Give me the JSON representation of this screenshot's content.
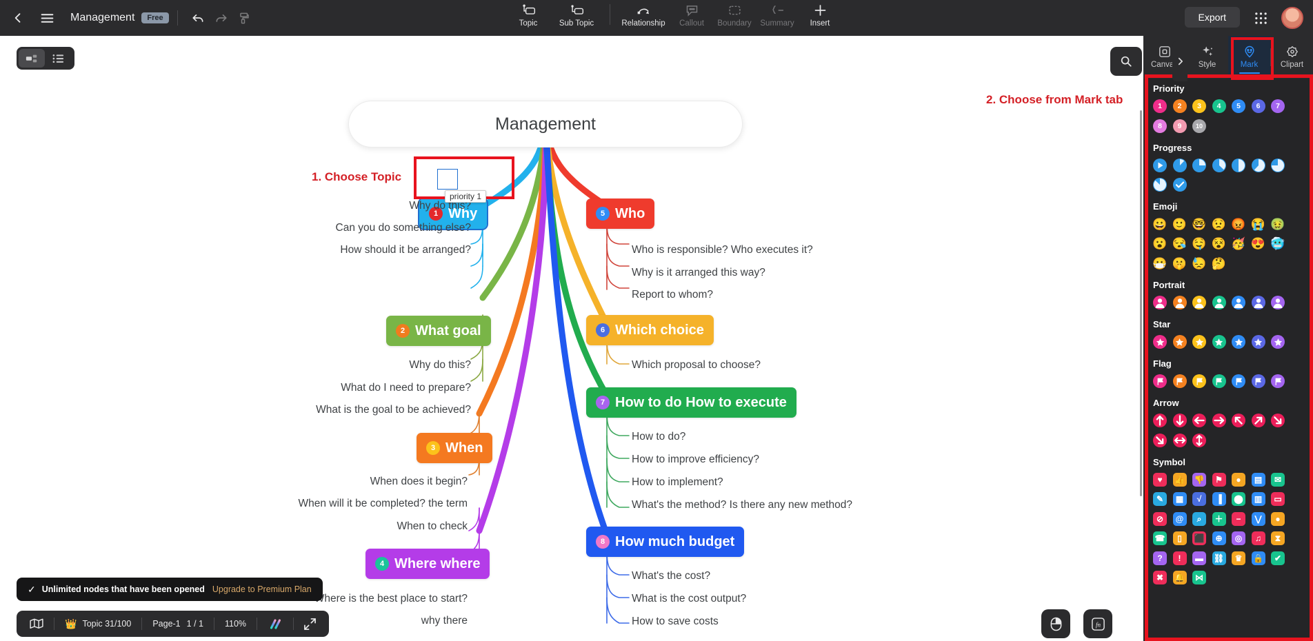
{
  "topbar": {
    "back_icon": "chevron-left-icon",
    "menu_icon": "hamburger-menu-icon",
    "doc_title": "Management",
    "plan_badge": "Free",
    "undo_icon": "undo-arrow-icon",
    "redo_icon": "redo-arrow-icon",
    "paint_icon": "format-painter-icon",
    "tools": [
      {
        "label": "Topic",
        "icon": "topic-icon",
        "dim": false
      },
      {
        "label": "Sub Topic",
        "icon": "sub-topic-icon",
        "dim": false
      },
      {
        "label": "Relationship",
        "icon": "relationship-arc-icon",
        "dim": false
      },
      {
        "label": "Callout",
        "icon": "callout-bubble-icon",
        "dim": true
      },
      {
        "label": "Boundary",
        "icon": "boundary-icon",
        "dim": true
      },
      {
        "label": "Summary",
        "icon": "summary-bracket-icon",
        "dim": true
      },
      {
        "label": "Insert",
        "icon": "plus-icon",
        "dim": false
      }
    ],
    "export_label": "Export",
    "grid_icon": "apps-grid-icon",
    "avatar_icon": "user-avatar"
  },
  "canvas_controls": {
    "view_map_icon": "mindmap-view-icon",
    "view_outline_icon": "outline-list-icon",
    "search_icon": "search-icon",
    "collapse_icon": "chevron-right-icon"
  },
  "annotations": {
    "step1": "1. Choose Topic",
    "step2": "2. Choose from Mark tab",
    "accent_color": "#d42026"
  },
  "mindmap": {
    "root": "Management",
    "tooltip": "priority 1",
    "branches": [
      {
        "title": "Why",
        "number": "1",
        "color": "#22b1ec",
        "badge_color": "#e4282b",
        "side": "left",
        "selected": true,
        "children": [
          "Why do this?",
          "Can you do something else?",
          "How should it be arranged?"
        ]
      },
      {
        "title": "What goal",
        "number": "2",
        "color": "#79b547",
        "badge_color": "#f07c1e",
        "side": "left",
        "selected": false,
        "children": [
          "Why do this?",
          "What do I need to prepare?",
          "What is the goal to be achieved?"
        ]
      },
      {
        "title": "When",
        "number": "3",
        "color": "#f47920",
        "badge_color": "#fcc21b",
        "side": "left",
        "selected": false,
        "children": [
          "When does it begin?",
          "When will it be completed? the term",
          "When to check"
        ]
      },
      {
        "title": "Where where",
        "number": "4",
        "color": "#b43ce8",
        "badge_color": "#1bc49a",
        "side": "left",
        "selected": false,
        "children": [
          "Where is the best place to start?",
          "why there"
        ]
      },
      {
        "title": "Who",
        "number": "5",
        "color": "#ef3b2d",
        "badge_color": "#2f8cf5",
        "side": "right",
        "selected": false,
        "children": [
          "Who is responsible? Who executes it?",
          "Why is it arranged this way?",
          "Report to whom?"
        ]
      },
      {
        "title": "Which choice",
        "number": "6",
        "color": "#f5b22a",
        "badge_color": "#4a6ee0",
        "side": "right",
        "selected": false,
        "children": [
          "Which proposal to choose?"
        ]
      },
      {
        "title": "How to do How to execute",
        "number": "7",
        "color": "#21ac4e",
        "badge_color": "#a964ef",
        "side": "right",
        "selected": false,
        "children": [
          "How to do?",
          "How to improve efficiency?",
          "How to implement?",
          "What's the method? Is there any new method?"
        ]
      },
      {
        "title": "How much budget",
        "number": "8",
        "color": "#2059f0",
        "badge_color": "#f079c8",
        "side": "right",
        "selected": false,
        "children": [
          "What's the cost?",
          "What is the cost output?",
          "How to save costs"
        ]
      }
    ]
  },
  "toast": {
    "check_icon": "check-icon",
    "message": "Unlimited nodes that have been opened",
    "upgrade_label": "Upgrade to Premium Plan"
  },
  "statusbar": {
    "map_icon": "map-outline-icon",
    "crown_icon": "crown-icon",
    "topic_count": "Topic 31/100",
    "page_label": "Page-1",
    "page_position": "1 / 1",
    "zoom": "110%",
    "theme_icon": "theme-gradient-icon",
    "fullscreen_icon": "fullscreen-icon"
  },
  "fabs": {
    "mouse_icon": "mouse-icon",
    "fn_icon": "fn-key-icon"
  },
  "right_panel": {
    "tabs": [
      {
        "label": "Canvas",
        "icon": "canvas-icon",
        "active": false
      },
      {
        "label": "Style",
        "icon": "sparkle-style-icon",
        "active": false
      },
      {
        "label": "Mark",
        "icon": "mark-pin-icon",
        "active": true
      },
      {
        "label": "Clipart",
        "icon": "clipart-icon",
        "active": false
      }
    ],
    "sections": [
      {
        "title": "Priority",
        "kind": "priority",
        "items": [
          {
            "label": "1",
            "color": "#ef2d8a"
          },
          {
            "label": "2",
            "color": "#f58220"
          },
          {
            "label": "3",
            "color": "#fcc21b"
          },
          {
            "label": "4",
            "color": "#18c48e"
          },
          {
            "label": "5",
            "color": "#2f8cf5"
          },
          {
            "label": "6",
            "color": "#5b68e5"
          },
          {
            "label": "7",
            "color": "#a465f0"
          },
          {
            "label": "8",
            "color": "#e47be0"
          },
          {
            "label": "9",
            "color": "#f29ab0"
          },
          {
            "label": "10",
            "color": "#a8a8ac"
          }
        ]
      },
      {
        "title": "Progress",
        "kind": "progress",
        "items": [
          {
            "name": "progress-start-icon",
            "pct": 0
          },
          {
            "name": "progress-1-8-icon",
            "pct": 12
          },
          {
            "name": "progress-1-4-icon",
            "pct": 25
          },
          {
            "name": "progress-3-8-icon",
            "pct": 37
          },
          {
            "name": "progress-1-2-icon",
            "pct": 50
          },
          {
            "name": "progress-5-8-icon",
            "pct": 62
          },
          {
            "name": "progress-3-4-icon",
            "pct": 75
          },
          {
            "name": "progress-7-8-icon",
            "pct": 87
          },
          {
            "name": "progress-done-icon",
            "pct": 100
          }
        ]
      },
      {
        "title": "Emoji",
        "kind": "emoji",
        "items": [
          {
            "name": "grinning-face",
            "glyph": "😀"
          },
          {
            "name": "smiling-face",
            "glyph": "🙂"
          },
          {
            "name": "nerd-face",
            "glyph": "🤓"
          },
          {
            "name": "worried-face",
            "glyph": "😟"
          },
          {
            "name": "angry-face",
            "glyph": "😡"
          },
          {
            "name": "crying-face",
            "glyph": "😭"
          },
          {
            "name": "nauseated-face",
            "glyph": "🤢"
          },
          {
            "name": "surprised-face",
            "glyph": "😮"
          },
          {
            "name": "sleepy-face",
            "glyph": "😪"
          },
          {
            "name": "drooling-face",
            "glyph": "🤤"
          },
          {
            "name": "dizzy-face",
            "glyph": "😵"
          },
          {
            "name": "partying-face",
            "glyph": "🥳"
          },
          {
            "name": "heart-eyes-face",
            "glyph": "😍"
          },
          {
            "name": "cold-face",
            "glyph": "🥶"
          },
          {
            "name": "mask-face",
            "glyph": "😷"
          },
          {
            "name": "shushing-face",
            "glyph": "🤫"
          },
          {
            "name": "sweating-face",
            "glyph": "😓"
          },
          {
            "name": "thinking-face",
            "glyph": "🤔"
          }
        ]
      },
      {
        "title": "Portrait",
        "kind": "portrait",
        "items": [
          {
            "color": "#ef2d8a"
          },
          {
            "color": "#f58220"
          },
          {
            "color": "#fcc21b"
          },
          {
            "color": "#18c48e"
          },
          {
            "color": "#2f8cf5"
          },
          {
            "color": "#5b68e5"
          },
          {
            "color": "#a465f0"
          }
        ]
      },
      {
        "title": "Star",
        "kind": "star",
        "items": [
          {
            "color": "#ef2d8a"
          },
          {
            "color": "#f58220"
          },
          {
            "color": "#fcc21b"
          },
          {
            "color": "#18c48e"
          },
          {
            "color": "#2f8cf5"
          },
          {
            "color": "#5b68e5"
          },
          {
            "color": "#a465f0"
          }
        ]
      },
      {
        "title": "Flag",
        "kind": "flag",
        "items": [
          {
            "color": "#ef2d8a"
          },
          {
            "color": "#f58220"
          },
          {
            "color": "#fcc21b"
          },
          {
            "color": "#18c48e"
          },
          {
            "color": "#2f8cf5"
          },
          {
            "color": "#5b68e5"
          },
          {
            "color": "#a465f0"
          }
        ]
      },
      {
        "title": "Arrow",
        "kind": "arrow",
        "color": "#ec1e5a",
        "items": [
          {
            "name": "arrow-up-icon",
            "rot": 0
          },
          {
            "name": "arrow-down-icon",
            "rot": 180
          },
          {
            "name": "arrow-left-icon",
            "rot": 270
          },
          {
            "name": "arrow-right-icon",
            "rot": 90
          },
          {
            "name": "arrow-up-left-icon",
            "rot": 315
          },
          {
            "name": "arrow-up-right-icon",
            "rot": 45
          },
          {
            "name": "arrow-down-right-icon",
            "rot": 135
          },
          {
            "name": "arrow-down-right-2-icon",
            "rot": 135
          },
          {
            "name": "arrow-left-right-icon",
            "rot": 0
          },
          {
            "name": "arrow-up-down-icon",
            "rot": 0
          }
        ]
      },
      {
        "title": "Symbol",
        "kind": "symbol",
        "items": [
          {
            "name": "heart-icon",
            "glyph": "♥",
            "color": "#ef2d5a"
          },
          {
            "name": "thumbs-up-icon",
            "glyph": "👍",
            "color": "#f5a623"
          },
          {
            "name": "thumbs-down-icon",
            "glyph": "👎",
            "color": "#a465f0"
          },
          {
            "name": "star-badge-icon",
            "glyph": "⚑",
            "color": "#ef2d5a"
          },
          {
            "name": "coin-icon",
            "glyph": "●",
            "color": "#f5a623"
          },
          {
            "name": "document-icon",
            "glyph": "▤",
            "color": "#2f8cf5"
          },
          {
            "name": "email-icon",
            "glyph": "✉",
            "color": "#18c48e"
          },
          {
            "name": "edit-icon",
            "glyph": "✎",
            "color": "#29a9e0"
          },
          {
            "name": "table-icon",
            "glyph": "▦",
            "color": "#2f8cf5"
          },
          {
            "name": "formula-icon",
            "glyph": "√",
            "color": "#4a6ee0"
          },
          {
            "name": "bar-chart-icon",
            "glyph": "▐",
            "color": "#2f8cf5"
          },
          {
            "name": "location-pin-icon",
            "glyph": "⬤",
            "color": "#18c48e"
          },
          {
            "name": "calendar-icon",
            "glyph": "▥",
            "color": "#2f8cf5"
          },
          {
            "name": "chat-icon",
            "glyph": "▭",
            "color": "#ef2d5a"
          },
          {
            "name": "forbidden-icon",
            "glyph": "⊘",
            "color": "#ef2d5a"
          },
          {
            "name": "at-sign-icon",
            "glyph": "@",
            "color": "#2f8cf5"
          },
          {
            "name": "magnifier-icon",
            "glyph": "⌕",
            "color": "#29a9e0"
          },
          {
            "name": "plus-icon",
            "glyph": "＋",
            "color": "#18c48e"
          },
          {
            "name": "minus-icon",
            "glyph": "−",
            "color": "#ef2d5a"
          },
          {
            "name": "share-icon",
            "glyph": "⋁",
            "color": "#2f8cf5"
          },
          {
            "name": "users-icon",
            "glyph": "●",
            "color": "#f5a623"
          },
          {
            "name": "phone-icon",
            "glyph": "☎",
            "color": "#18c48e"
          },
          {
            "name": "mobile-icon",
            "glyph": "▯",
            "color": "#f5a623"
          },
          {
            "name": "gift-icon",
            "glyph": "⬛",
            "color": "#ef2d5a"
          },
          {
            "name": "globe-icon",
            "glyph": "⊕",
            "color": "#2f8cf5"
          },
          {
            "name": "target-icon",
            "glyph": "◎",
            "color": "#a465f0"
          },
          {
            "name": "music-icon",
            "glyph": "♫",
            "color": "#ef2d5a"
          },
          {
            "name": "hourglass-icon",
            "glyph": "⧗",
            "color": "#f5a623"
          },
          {
            "name": "question-icon",
            "glyph": "?",
            "color": "#a465f0"
          },
          {
            "name": "exclamation-icon",
            "glyph": "!",
            "color": "#ef2d5a"
          },
          {
            "name": "gamepad-icon",
            "glyph": "▬",
            "color": "#a465f0"
          },
          {
            "name": "link-icon",
            "glyph": "⛓",
            "color": "#29a9e0"
          },
          {
            "name": "trophy-icon",
            "glyph": "♛",
            "color": "#f5a623"
          },
          {
            "name": "lock-icon",
            "glyph": "🔒",
            "color": "#2f8cf5"
          },
          {
            "name": "check-icon",
            "glyph": "✔",
            "color": "#18c48e"
          },
          {
            "name": "cross-icon",
            "glyph": "✖",
            "color": "#ef2d5a"
          },
          {
            "name": "bell-icon",
            "glyph": "🔔",
            "color": "#f5a623"
          },
          {
            "name": "mindmap-icon",
            "glyph": "⋈",
            "color": "#18c48e"
          }
        ]
      }
    ]
  }
}
